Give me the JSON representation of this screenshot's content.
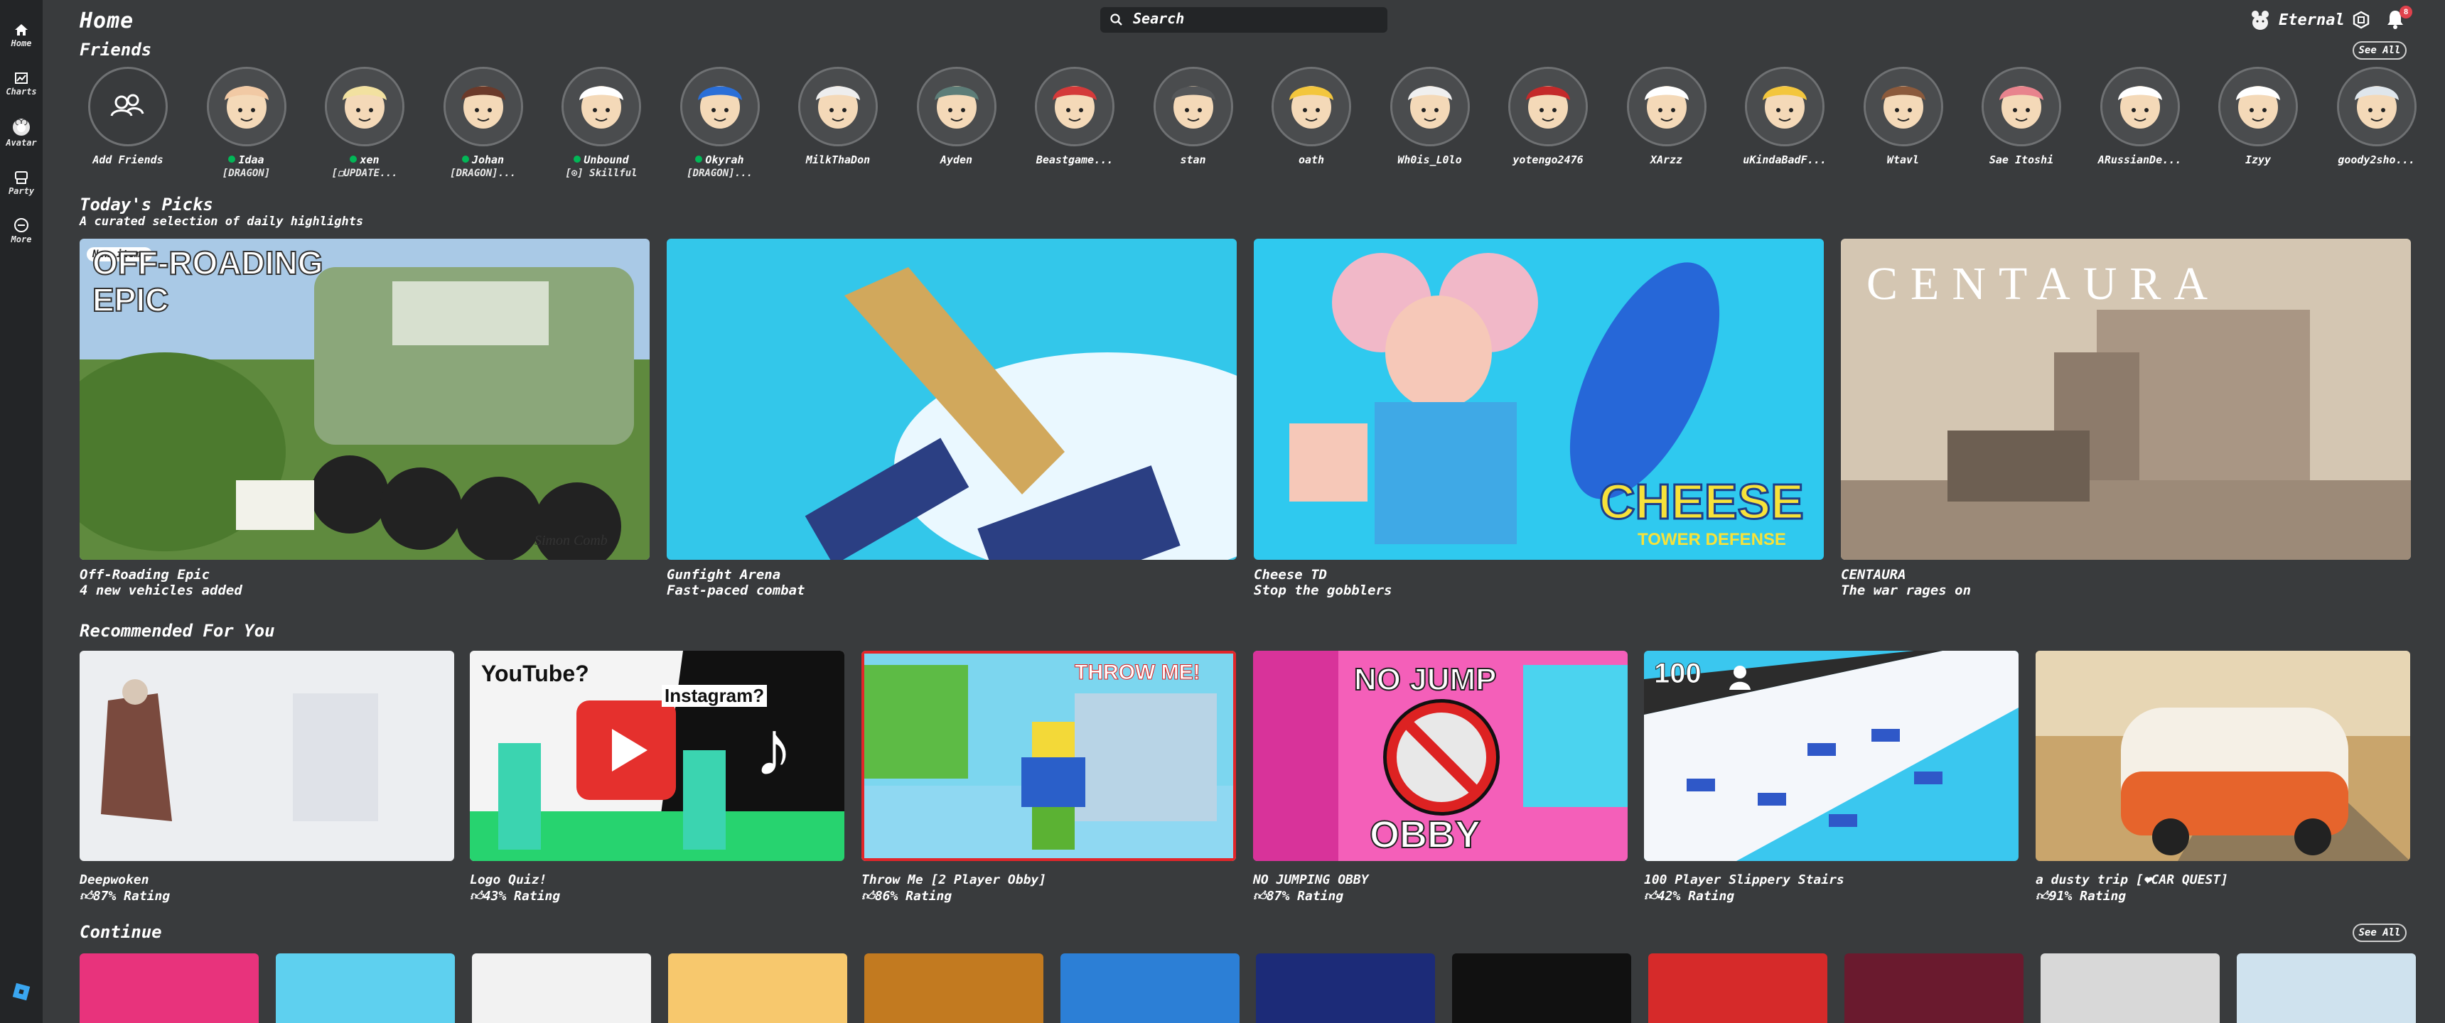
{
  "nav": {
    "items": [
      {
        "label": "Home",
        "icon": "home-icon"
      },
      {
        "label": "Charts",
        "icon": "charts-icon"
      },
      {
        "label": "Avatar",
        "icon": "avatar-icon"
      },
      {
        "label": "Party",
        "icon": "party-icon"
      },
      {
        "label": "More",
        "icon": "more-icon"
      }
    ]
  },
  "header": {
    "title": "Home",
    "search_placeholder": "Search",
    "user_name": "Eternal",
    "notification_count": "8"
  },
  "friends": {
    "title": "Friends",
    "see_all": "See All",
    "add_label": "Add Friends",
    "list": [
      {
        "name": "Idaa",
        "status": "[DRAGON]",
        "online": true,
        "color": "#f1c9a4"
      },
      {
        "name": "xen",
        "status": "[☐UPDATE...",
        "online": true,
        "color": "#f2e1a0"
      },
      {
        "name": "Johan",
        "status": "[DRAGON]...",
        "online": true,
        "color": "#6b3a2a"
      },
      {
        "name": "Unbound",
        "status": "[⊙] Skillful",
        "online": true,
        "color": "#ffffff"
      },
      {
        "name": "Okyrah",
        "status": "[DRAGON]...",
        "online": true,
        "color": "#2b6fd8"
      },
      {
        "name": "MilkThaDon",
        "status": "",
        "online": false,
        "color": "#eeeeee"
      },
      {
        "name": "Ayden",
        "status": "",
        "online": false,
        "color": "#5d7d78"
      },
      {
        "name": "Beastgame...",
        "status": "",
        "online": false,
        "color": "#d43a3a"
      },
      {
        "name": "stan",
        "status": "",
        "online": false,
        "color": "#555759"
      },
      {
        "name": "oath",
        "status": "",
        "online": false,
        "color": "#f3c63d"
      },
      {
        "name": "Wh0is_L0lo",
        "status": "",
        "online": false,
        "color": "#f0f0f0"
      },
      {
        "name": "yotengo2476",
        "status": "",
        "online": false,
        "color": "#c42a2a"
      },
      {
        "name": "XArzz",
        "status": "",
        "online": false,
        "color": "#ffffff"
      },
      {
        "name": "uKindaBadF...",
        "status": "",
        "online": false,
        "color": "#f3c63d"
      },
      {
        "name": "Wtavl",
        "status": "",
        "online": false,
        "color": "#8b5a3c"
      },
      {
        "name": "Sae Itoshi",
        "status": "",
        "online": false,
        "color": "#e8838d"
      },
      {
        "name": "ARussianDe...",
        "status": "",
        "online": false,
        "color": "#ffffff"
      },
      {
        "name": "Izyy",
        "status": "",
        "online": false,
        "color": "#ffffff"
      },
      {
        "name": "goody2sho...",
        "status": "",
        "online": false,
        "color": "#dfe6ec"
      }
    ]
  },
  "picks": {
    "title": "Today's Picks",
    "subtitle": "A curated selection of daily highlights",
    "new_badge": "New items",
    "items": [
      {
        "title": "Off-Roading Epic",
        "subtitle": "4 new vehicles added",
        "art_text": "OFF-ROADING EPIC",
        "art_color": "#8fb06e",
        "sig": "Simon Comb"
      },
      {
        "title": "Gunfight Arena",
        "subtitle": "Fast-paced combat",
        "art_color": "#35c8ea"
      },
      {
        "title": "Cheese TD",
        "subtitle": "Stop the gobblers",
        "art_text": "CHEESE",
        "art_sub": "TOWER DEFENSE",
        "art_color": "#2fc9ef"
      },
      {
        "title": "CENTAURA",
        "subtitle": "The war rages on",
        "art_text": "CENTAURA",
        "art_color": "#c9b9a2"
      }
    ]
  },
  "recommended": {
    "title": "Recommended For You",
    "items": [
      {
        "title": "Deepwoken",
        "rating": "87% Rating",
        "art_color": "#eeeff2"
      },
      {
        "title": "Logo Quiz!",
        "rating": "43% Rating",
        "art_text_1": "YouTube?",
        "art_text_2": "Instagram?",
        "art_color": "#f4f4f4"
      },
      {
        "title": "Throw Me [2 Player Obby]",
        "rating": "86% Rating",
        "art_text": "THROW ME!",
        "art_color": "#7cd6ef"
      },
      {
        "title": "NO JUMPING OBBY",
        "rating": "87% Rating",
        "art_text_1": "NO JUMP",
        "art_text_2": "OBBY",
        "art_color": "#f45fb9"
      },
      {
        "title": "100 Player Slippery Stairs",
        "rating": "42% Rating",
        "art_text": "100",
        "art_color": "#3ac7ef"
      },
      {
        "title": "a dusty trip [❤CAR QUEST]",
        "rating": "91% Rating",
        "art_color": "#c9a56c"
      }
    ]
  },
  "continue": {
    "title": "Continue",
    "see_all": "See All",
    "colors": [
      "#e8337c",
      "#5ed0ef",
      "#f2f2f2",
      "#f7c86d",
      "#c27a20",
      "#2c7fd6",
      "#1c2b78",
      "#111111",
      "#d62a2a",
      "#6a1a2e",
      "#d8d8d8",
      "#cfe2ee"
    ]
  },
  "colors": {
    "background": "#393b3d",
    "rail": "#232527",
    "accent_online": "#02b757",
    "badge": "#e0414c"
  }
}
